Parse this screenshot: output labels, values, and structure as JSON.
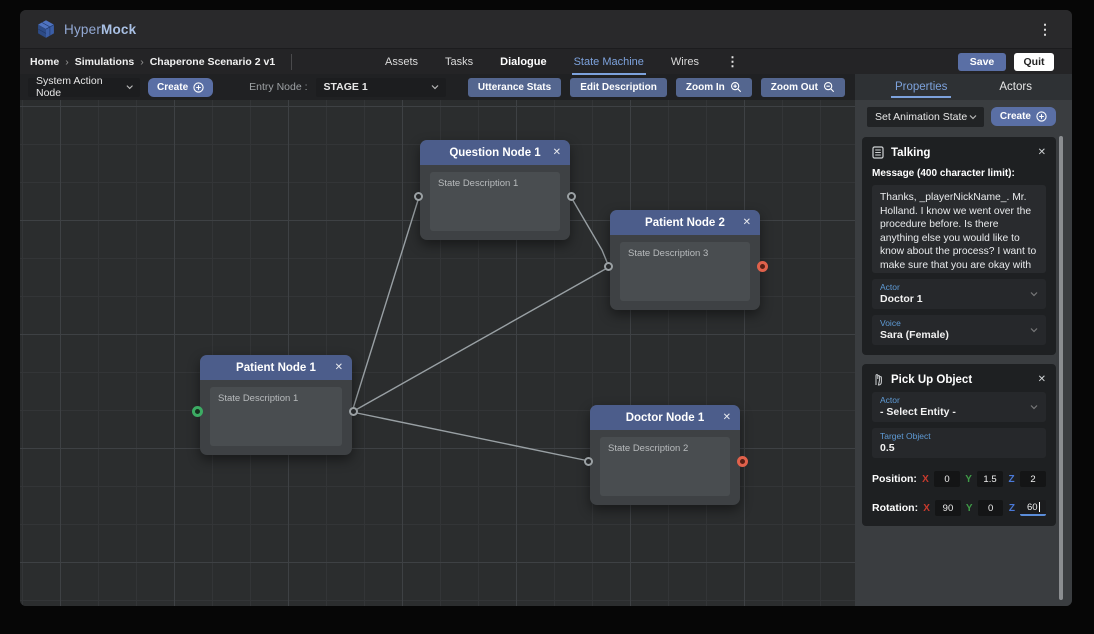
{
  "brand": {
    "hyper": "Hyper",
    "mock": "Mock"
  },
  "glyphs": {
    "close": "✕",
    "kebab": "⋮",
    "breadcrumb_sep": "›"
  },
  "nav": {
    "breadcrumb": [
      "Home",
      "Simulations",
      "Chaperone Scenario 2 v1"
    ],
    "tabs": [
      {
        "label": "Assets"
      },
      {
        "label": "Tasks"
      },
      {
        "label": "Dialogue"
      },
      {
        "label": "State Machine"
      },
      {
        "label": "Wires"
      }
    ],
    "active_tab": "State Machine",
    "save_label": "Save",
    "quit_label": "Quit"
  },
  "toolbar": {
    "node_type_value": "System Action Node",
    "create_label": "Create",
    "entry_node_label": "Entry Node :",
    "entry_node_value": "STAGE 1",
    "utterance_stats_label": "Utterance Stats",
    "edit_description_label": "Edit Description",
    "zoom_in_label": "Zoom In",
    "zoom_out_label": "Zoom Out"
  },
  "panel": {
    "tab_properties": "Properties",
    "tab_actors": "Actors",
    "action_dropdown_value": "Set Animation State",
    "create_label": "Create",
    "talking": {
      "title": "Talking",
      "message_label": "Message (400 character limit):",
      "message_text": "Thanks, _playerNickName_. Mr. Holland. I know we went over the procedure before. Is there anything else you would like to know about the process? I want to make sure that you are okay with going forward.",
      "actor_label": "Actor",
      "actor_value": "Doctor 1",
      "voice_label": "Voice",
      "voice_value": "Sara (Female)"
    },
    "pickup": {
      "title": "Pick Up Object",
      "actor_label": "Actor",
      "actor_value": "- Select Entity -",
      "target_label": "Target Object",
      "target_value": "0.5",
      "position_label": "Position:",
      "rotation_label": "Rotation:",
      "axis": {
        "x": "X",
        "y": "Y",
        "z": "Z"
      },
      "position": {
        "x": "0",
        "y": "1.5",
        "z": "2"
      },
      "rotation": {
        "x": "90",
        "y": "0",
        "z": "60"
      }
    }
  },
  "canvas": {
    "nodes": [
      {
        "title": "Question Node 1",
        "description": "State Description 1",
        "left_port": "gray",
        "right_port": "gray"
      },
      {
        "title": "Patient Node 2",
        "description": "State Description 3",
        "left_port": "gray",
        "right_port": "red"
      },
      {
        "title": "Patient Node 1",
        "description": "State Description 1",
        "left_port": "green",
        "right_port": "gray"
      },
      {
        "title": "Doctor Node 1",
        "description": "State Description 2",
        "left_port": "gray",
        "right_port": "red"
      }
    ],
    "connections": [
      "Patient Node 1 → Question Node 1",
      "Patient Node 1 → Patient Node 2",
      "Patient Node 1 → Doctor Node 1",
      "Question Node 1 → Patient Node 2"
    ]
  },
  "colors": {
    "accent_blue": "#5a6fa5",
    "tab_active_blue": "#7da2dc",
    "node_header_blue": "#4c5d8b",
    "port_green": "#3cab63",
    "port_red": "#e0614b",
    "axis_x_red": "#c83a2d",
    "axis_y_green": "#3f9b47",
    "axis_z_blue": "#4a79d8",
    "wire_gray": "#99a0a4"
  }
}
